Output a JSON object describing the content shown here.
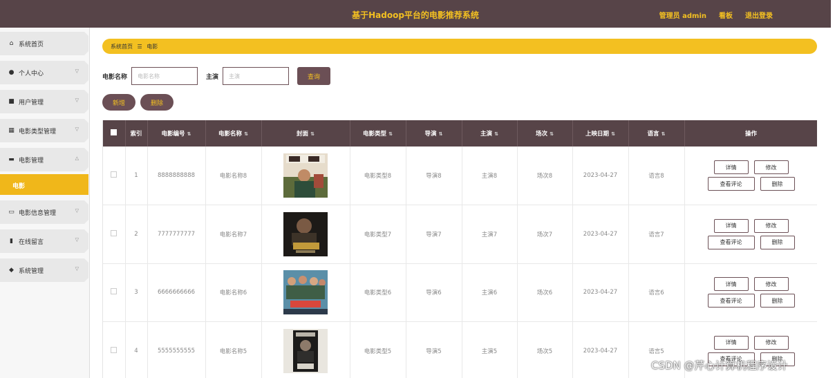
{
  "header": {
    "title": "基于Hadoop平台的电影推荐系统",
    "user_label": "管理员 admin",
    "board_label": "看板",
    "logout_label": "退出登录"
  },
  "sidebar": {
    "items": [
      {
        "label": "系统首页",
        "icon": "home-icon",
        "expanded": false
      },
      {
        "label": "个人中心",
        "icon": "user-icon",
        "expanded": false
      },
      {
        "label": "用户管理",
        "icon": "monitor-icon",
        "expanded": false
      },
      {
        "label": "电影类型管理",
        "icon": "grid-icon",
        "expanded": false
      },
      {
        "label": "电影管理",
        "icon": "briefcase-icon",
        "expanded": true
      },
      {
        "label": "电影信息管理",
        "icon": "comment-icon",
        "expanded": false
      },
      {
        "label": "在线留言",
        "icon": "bar-chart-icon",
        "expanded": false
      },
      {
        "label": "系统管理",
        "icon": "tag-icon",
        "expanded": false
      }
    ],
    "active_sub": "电影"
  },
  "breadcrumb": {
    "home": "系统首页",
    "separator": "☰",
    "current": "电影"
  },
  "search": {
    "name_label": "电影名称",
    "name_placeholder": "电影名称",
    "actor_label": "主演",
    "actor_placeholder": "主演",
    "query_label": "查询"
  },
  "actions": {
    "add_label": "新增",
    "delete_label": "删除"
  },
  "table": {
    "columns": [
      "索引",
      "电影编号",
      "电影名称",
      "封面",
      "电影类型",
      "导演",
      "主演",
      "场次",
      "上映日期",
      "语言",
      "操作"
    ],
    "rows": [
      {
        "index": "1",
        "code": "8888888888",
        "name": "电影名称8",
        "type": "电影类型8",
        "director": "导演8",
        "actor": "主演8",
        "session": "场次8",
        "date": "2023-04-27",
        "language": "语言8"
      },
      {
        "index": "2",
        "code": "7777777777",
        "name": "电影名称7",
        "type": "电影类型7",
        "director": "导演7",
        "actor": "主演7",
        "session": "场次7",
        "date": "2023-04-27",
        "language": "语言7"
      },
      {
        "index": "3",
        "code": "6666666666",
        "name": "电影名称6",
        "type": "电影类型6",
        "director": "导演6",
        "actor": "主演6",
        "session": "场次6",
        "date": "2023-04-27",
        "language": "语言6"
      },
      {
        "index": "4",
        "code": "5555555555",
        "name": "电影名称5",
        "type": "电影类型5",
        "director": "导演5",
        "actor": "主演5",
        "session": "场次5",
        "date": "2023-04-27",
        "language": "语言5"
      }
    ],
    "ops": {
      "detail": "详情",
      "edit": "修改",
      "comments": "查看评论",
      "delete": "删除"
    }
  },
  "watermark": "CSDN @芹心计算机程序设计",
  "colors": {
    "header_bg": "#574448",
    "accent": "#f3c021",
    "button_bg": "#6b4f55"
  }
}
